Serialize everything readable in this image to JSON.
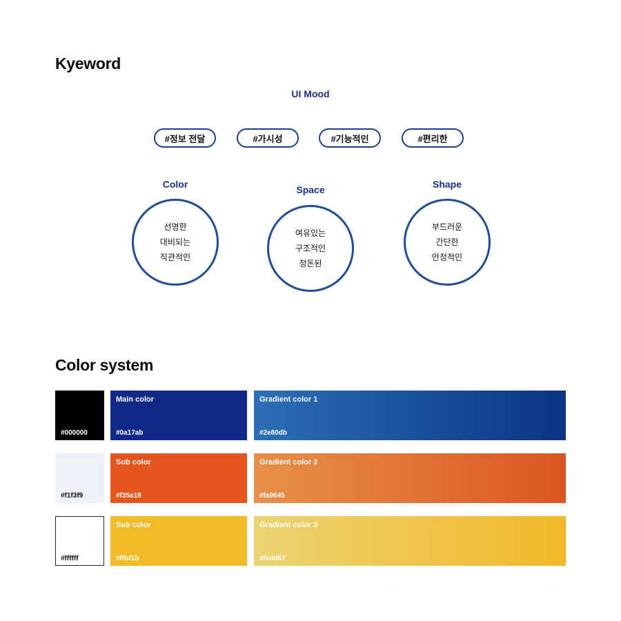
{
  "keyword": {
    "title": "Kyeword",
    "mood_title": "UI Mood",
    "tags": [
      "#정보 전달",
      "#가시성",
      "#기능적인",
      "#편리한"
    ],
    "categories": [
      {
        "title": "Color",
        "lines": [
          "선명한",
          "대비되는",
          "직관적인"
        ]
      },
      {
        "title": "Space",
        "lines": [
          "여유있는",
          "구조적인",
          "정돈된"
        ]
      },
      {
        "title": "Shape",
        "lines": [
          "부드러운",
          "간단한",
          "안정적인"
        ]
      }
    ]
  },
  "color_system": {
    "title": "Color system",
    "rows": [
      {
        "neutral": {
          "hex_label": "#000000",
          "color": "#000000"
        },
        "solid": {
          "name": "Main color",
          "hex_label": "#0a17ab",
          "color": "#13298a"
        },
        "gradient": {
          "name": "Gradient color 1",
          "hex_label": "#2e80db",
          "from": "#2c6fb4",
          "to": "#0b3482"
        }
      },
      {
        "neutral": {
          "hex_label": "#f1f3f9",
          "color": "#eef1f8"
        },
        "solid": {
          "name": "Sub color",
          "hex_label": "#f35a18",
          "color": "#e5561f"
        },
        "gradient": {
          "name": "Gradient color 2",
          "hex_label": "#fa9645",
          "from": "#e8904a",
          "to": "#db5621"
        }
      },
      {
        "neutral": {
          "hex_label": "#ffffff",
          "color": "#ffffff"
        },
        "solid": {
          "name": "Sub color",
          "hex_label": "#ffbf1b",
          "color": "#f3bb27"
        },
        "gradient": {
          "name": "Gradient color 3",
          "hex_label": "#fedd67",
          "from": "#ecd372",
          "to": "#f2b829"
        }
      }
    ]
  }
}
